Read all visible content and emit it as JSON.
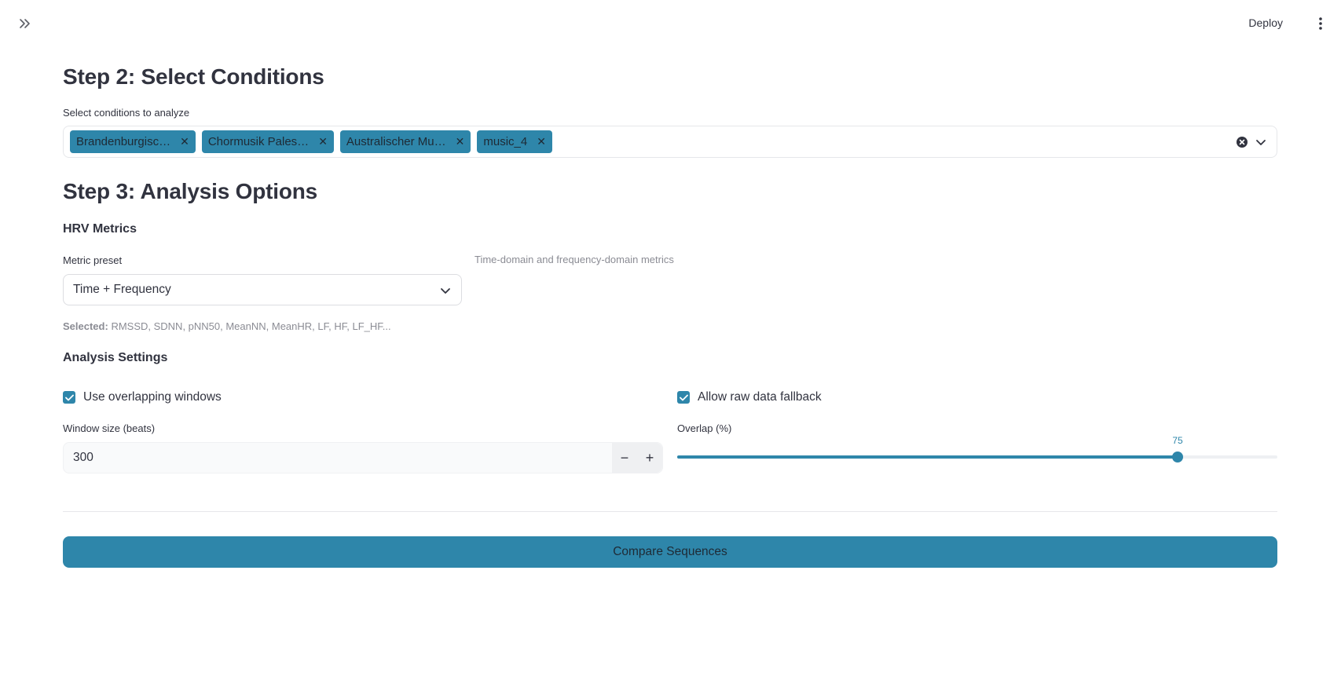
{
  "header": {
    "deploy_label": "Deploy",
    "expand_icon": "double-chevron-right-icon",
    "menu_icon": "kebab-menu-icon"
  },
  "step2": {
    "title": "Step 2: Select Conditions",
    "select_label": "Select conditions to analyze",
    "selected_conditions": [
      "Brandenburgisc…",
      "Chormusik Pales…",
      "Australischer Mu…",
      "music_4"
    ]
  },
  "step3": {
    "title": "Step 3: Analysis Options",
    "hrv_heading": "HRV Metrics",
    "metric_preset_label": "Metric preset",
    "metric_preset_value": "Time + Frequency",
    "preset_description": "Time-domain and frequency-domain metrics",
    "selected_prefix": "Selected:",
    "selected_metrics": "RMSSD, SDNN, pNN50, MeanNN, MeanHR, LF, HF, LF_HF...",
    "analysis_heading": "Analysis Settings",
    "use_overlapping_label": "Use overlapping windows",
    "use_overlapping_checked": true,
    "raw_fallback_label": "Allow raw data fallback",
    "raw_fallback_checked": true,
    "window_size_label": "Window size (beats)",
    "window_size_value": "300",
    "minus_label": "−",
    "plus_label": "+",
    "overlap_label": "Overlap (%)",
    "overlap_value": "75",
    "overlap_min": 0,
    "overlap_max": 90
  },
  "compare_button_label": "Compare Sequences",
  "colors": {
    "accent": "#2e86aa",
    "text": "#31333f",
    "muted": "#8b8c94"
  }
}
